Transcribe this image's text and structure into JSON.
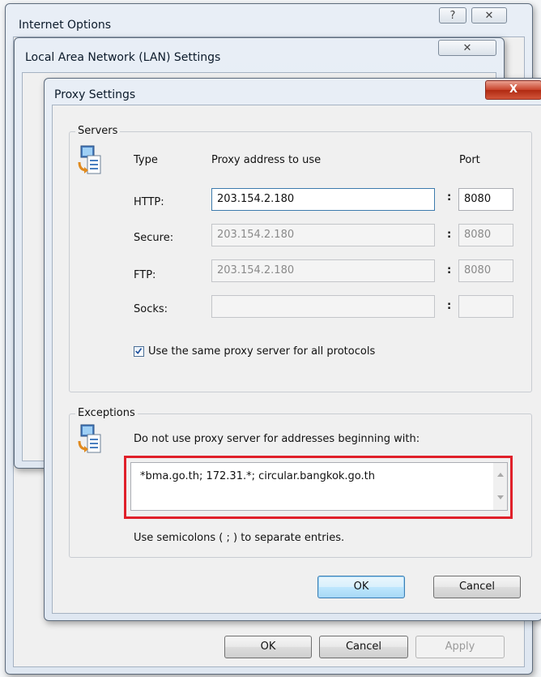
{
  "internet_options": {
    "title": "Internet Options",
    "help_glyph": "?",
    "close_glyph": "✕",
    "buttons": {
      "ok": "OK",
      "cancel": "Cancel",
      "apply": "Apply"
    }
  },
  "lan_settings": {
    "title": "Local Area Network (LAN) Settings",
    "close_glyph": "✕"
  },
  "proxy_settings": {
    "title": "Proxy Settings",
    "close_glyph": "X",
    "servers": {
      "legend": "Servers",
      "col_type": "Type",
      "col_address": "Proxy address to use",
      "col_port": "Port",
      "colon": ":",
      "rows": [
        {
          "type": "HTTP:",
          "address": "203.154.2.180",
          "port": "8080",
          "enabled": true
        },
        {
          "type": "Secure:",
          "address": "203.154.2.180",
          "port": "8080",
          "enabled": false
        },
        {
          "type": "FTP:",
          "address": "203.154.2.180",
          "port": "8080",
          "enabled": false
        },
        {
          "type": "Socks:",
          "address": "",
          "port": "",
          "enabled": false
        }
      ],
      "same_proxy_label": "Use the same proxy server for all protocols",
      "same_proxy_checked": true
    },
    "exceptions": {
      "legend": "Exceptions",
      "description": "Do not use proxy server for addresses beginning with:",
      "value": "*bma.go.th; 172.31.*; circular.bangkok.go.th",
      "hint": "Use semicolons ( ; ) to separate entries.",
      "highlight_color": "#e0202a"
    },
    "buttons": {
      "ok": "OK",
      "cancel": "Cancel"
    }
  }
}
